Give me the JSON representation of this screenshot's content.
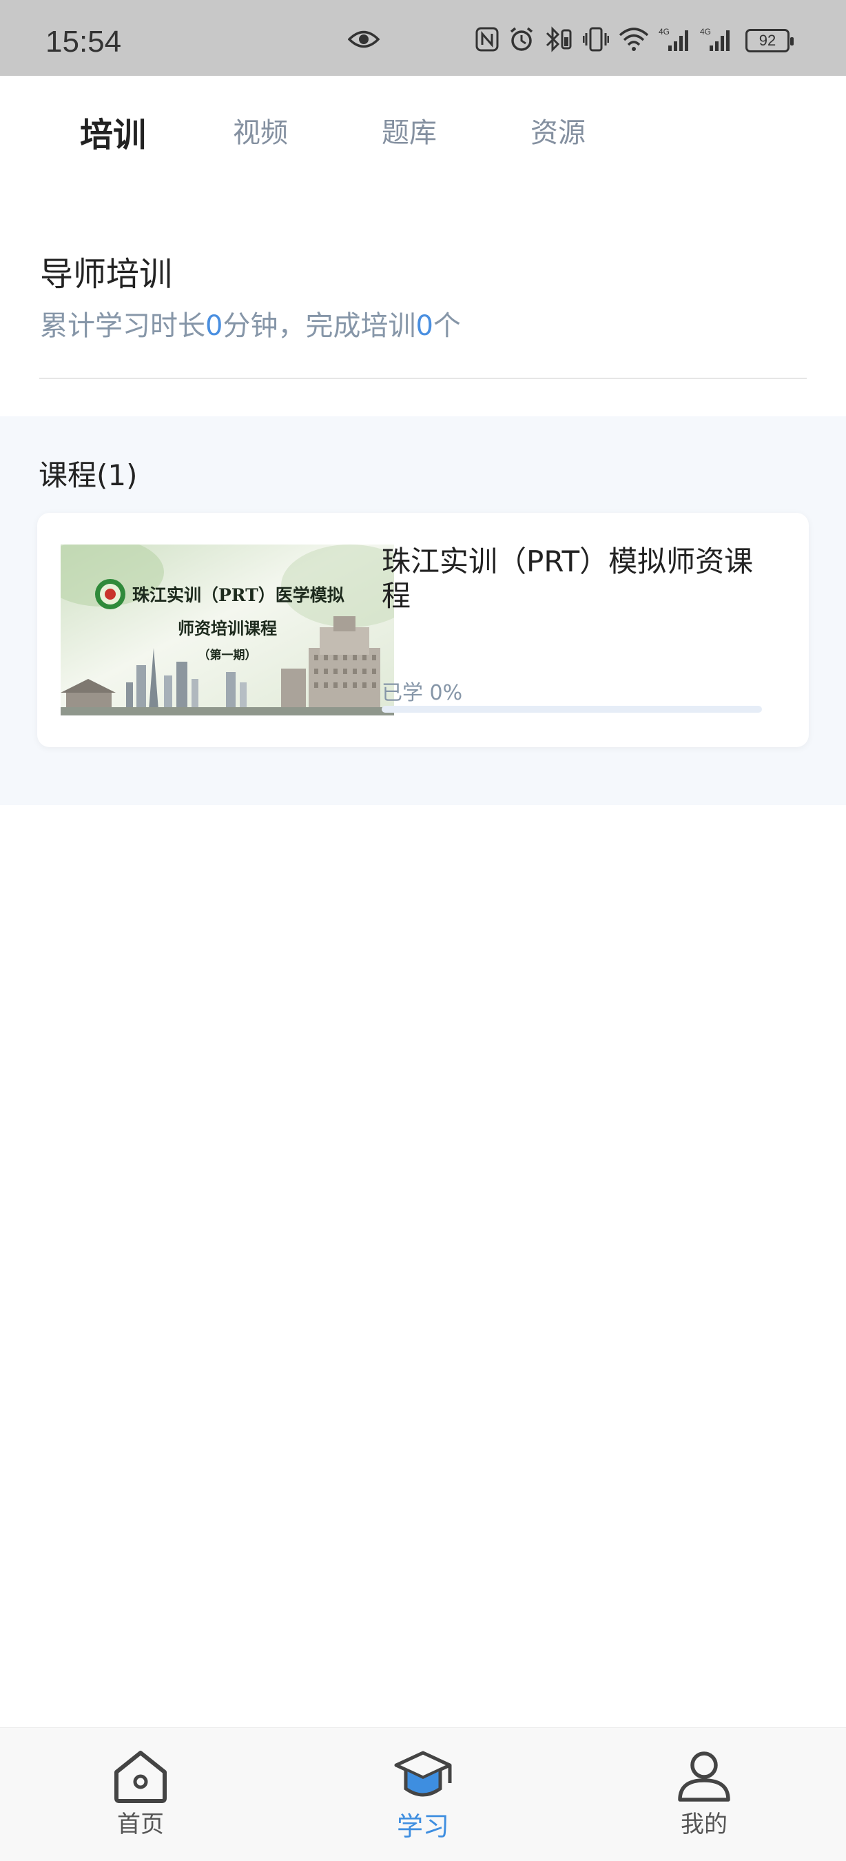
{
  "status_bar": {
    "time": "15:54",
    "battery": "92",
    "icons": [
      "eye-icon",
      "nfc-icon",
      "alarm-icon",
      "bluetooth-icon",
      "vibrate-icon",
      "wifi-icon",
      "signal-4g-icon",
      "signal-4g-icon",
      "battery-icon"
    ]
  },
  "tabs": [
    {
      "label": "培训",
      "active": true
    },
    {
      "label": "视频",
      "active": false
    },
    {
      "label": "题库",
      "active": false
    },
    {
      "label": "资源",
      "active": false
    }
  ],
  "header": {
    "title": "导师培训",
    "stats_prefix": "累计学习时长",
    "minutes": "0",
    "stats_mid": "分钟，完成培训",
    "completed": "0",
    "stats_suffix": "个"
  },
  "courses": {
    "heading": "课程(1)",
    "items": [
      {
        "thumbnail_line1": "珠江实训（PRT）医学模拟",
        "thumbnail_line2": "师资培训课程",
        "thumbnail_line3": "（第一期）",
        "title": "珠江实训（PRT）模拟师资课程",
        "progress_label": "已学 0%",
        "progress": 0
      }
    ]
  },
  "bottom_nav": [
    {
      "label": "首页",
      "icon": "home-icon",
      "active": false
    },
    {
      "label": "学习",
      "icon": "graduation-cap-icon",
      "active": true
    },
    {
      "label": "我的",
      "icon": "person-icon",
      "active": false
    }
  ],
  "colors": {
    "accent": "#4a8fe0",
    "muted_text": "#8696a8",
    "course_bg": "#f5f8fc"
  }
}
